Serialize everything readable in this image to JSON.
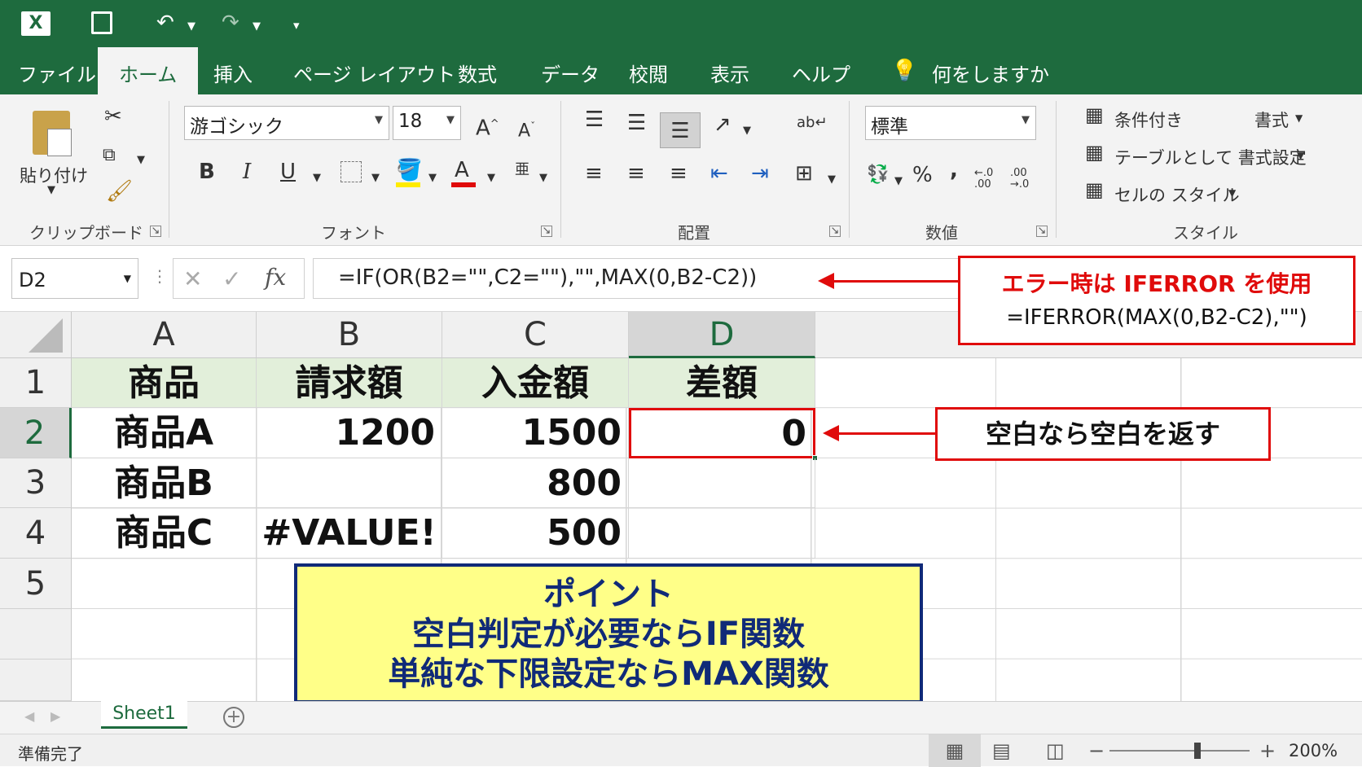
{
  "app": {
    "icon": "excel-icon"
  },
  "quick_access": {
    "icons": [
      "excel-icon",
      "save-icon",
      "undo-icon",
      "redo-icon",
      "customize-icon"
    ]
  },
  "tabs": [
    {
      "label": "ファイル"
    },
    {
      "label": "ホーム"
    },
    {
      "label": "挿入"
    },
    {
      "label": "ページ レイアウト"
    },
    {
      "label": "数式"
    },
    {
      "label": "データ"
    },
    {
      "label": "校閲"
    },
    {
      "label": "表示"
    },
    {
      "label": "ヘルプ"
    }
  ],
  "tellme": {
    "icon": "lightbulb-icon",
    "label": "何をしますか"
  },
  "ribbon": {
    "clipboard": {
      "paste": "貼り付け",
      "group": "クリップボード"
    },
    "font": {
      "name": "游ゴシック",
      "size": "18",
      "group": "フォント"
    },
    "alignment": {
      "group": "配置"
    },
    "number": {
      "format": "標準",
      "group": "数値",
      "percent": "%",
      "comma": ",",
      "inc_decimal": "←.0 .00",
      "dec_decimal": ".00 →.0"
    },
    "styles": {
      "conditional": "条件付き",
      "conditional_suffix": "書式",
      "table": "テーブルとして 書式設定",
      "cell": "セルの スタイル",
      "group": "スタイル"
    }
  },
  "formula_bar": {
    "name_box": "D2",
    "fx": "fx",
    "formula": "=IF(OR(B2=\"\",C2=\"\"),\"\",MAX(0,B2-C2))"
  },
  "columns": [
    "A",
    "B",
    "C",
    "D"
  ],
  "rows": [
    "1",
    "2",
    "3",
    "4",
    "5"
  ],
  "table": {
    "header": [
      "商品",
      "請求額",
      "入金額",
      "差額"
    ],
    "data": [
      [
        "商品A",
        "1200",
        "1500",
        "0"
      ],
      [
        "商品B",
        "",
        "800",
        ""
      ],
      [
        "商品C",
        "#VALUE!",
        "500",
        ""
      ]
    ]
  },
  "callouts": {
    "iferror_title": "エラー時は IFERROR を使用",
    "iferror_formula": "=IFERROR(MAX(0,B2-C2),\"\")",
    "blank_note": "空白なら空白を返す"
  },
  "point_box": {
    "line1": "ポイント",
    "line2": "空白判定が必要ならIF関数",
    "line3": "単純な下限設定ならMAX関数"
  },
  "sheet_tabs": [
    {
      "label": "Sheet1"
    }
  ],
  "status": {
    "text": "準備完了",
    "zoom": "200%",
    "minus": "−",
    "plus": "+"
  },
  "colors": {
    "ribbon_green": "#1e6b3e",
    "header_fill": "#e2efda",
    "callout_red": "#e00b0b",
    "point_fill": "#ffff88",
    "point_border": "#102a78"
  }
}
